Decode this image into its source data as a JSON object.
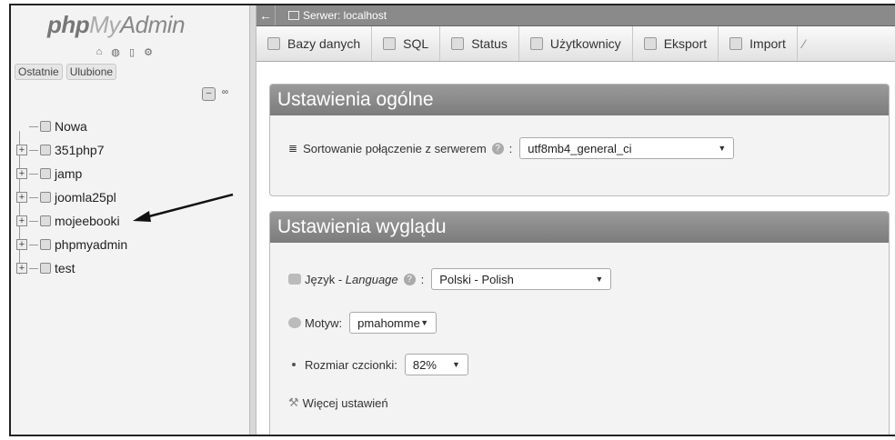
{
  "sidebar": {
    "logo": {
      "php": "php",
      "my": "My",
      "admin": "Admin"
    },
    "quick_icons": [
      "home-icon",
      "exit-icon",
      "docs-icon",
      "settings-icon"
    ],
    "tabs": [
      "Ostatnie",
      "Ulubione"
    ],
    "tree": [
      {
        "label": "Nowa",
        "type": "new"
      },
      {
        "label": "351php7",
        "type": "db"
      },
      {
        "label": "jamp",
        "type": "db"
      },
      {
        "label": "joomla25pl",
        "type": "db"
      },
      {
        "label": "mojeebooki",
        "type": "db"
      },
      {
        "label": "phpmyadmin",
        "type": "db"
      },
      {
        "label": "test",
        "type": "db"
      }
    ]
  },
  "topbar": {
    "back": "←",
    "server": "Serwer: localhost"
  },
  "menu": {
    "items": [
      "Bazy danych",
      "SQL",
      "Status",
      "Użytkownicy",
      "Eksport",
      "Import"
    ]
  },
  "general": {
    "title": "Ustawienia ogólne",
    "collation_label": "Sortowanie połączenie z serwerem",
    "collation_value": "utf8mb4_general_ci"
  },
  "appearance": {
    "title": "Ustawienia wyglądu",
    "language_label": "Język",
    "language_label_en": "Language",
    "language_value": "Polski - Polish",
    "theme_label": "Motyw:",
    "theme_value": "pmahomme",
    "font_size_label": "Rozmiar czcionki:",
    "font_size_value": "82%",
    "more_settings": "Więcej ustawień"
  }
}
